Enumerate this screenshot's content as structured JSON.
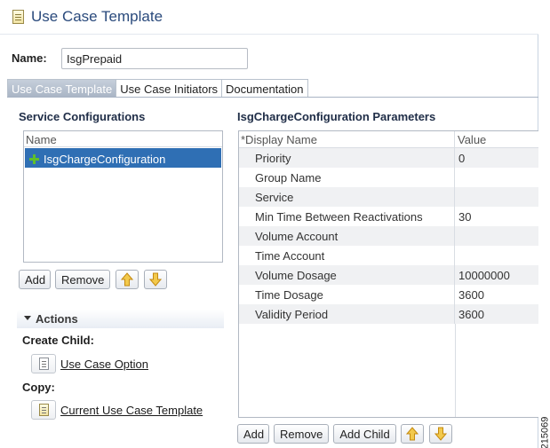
{
  "header": {
    "title": "Use Case Template",
    "icon": "template-doc-icon"
  },
  "name_field": {
    "label": "Name:",
    "value": "IsgPrepaid"
  },
  "tabs": [
    {
      "label": "Use Case Template",
      "active": true
    },
    {
      "label": "Use Case Initiators",
      "active": false
    },
    {
      "label": "Documentation",
      "active": false
    }
  ],
  "service_configurations": {
    "title": "Service Configurations",
    "column_header": "Name",
    "items": [
      {
        "label": "IsgChargeConfiguration",
        "selected": true,
        "icon": "plus-icon"
      }
    ],
    "buttons": {
      "add": "Add",
      "remove": "Remove",
      "up": "⇧",
      "down": "⇩"
    }
  },
  "actions": {
    "title": "Actions",
    "create_child_label": "Create Child:",
    "create_child_link": "Use Case Option",
    "copy_label": "Copy:",
    "copy_link": "Current Use Case Template"
  },
  "parameters": {
    "title": "IsgChargeConfiguration Parameters",
    "columns": [
      "*Display Name",
      "Value"
    ],
    "rows": [
      {
        "name": "Priority",
        "value": "0"
      },
      {
        "name": "Group Name",
        "value": ""
      },
      {
        "name": "Service",
        "value": ""
      },
      {
        "name": "Min Time Between Reactivations",
        "value": "30"
      },
      {
        "name": "Volume Account",
        "value": ""
      },
      {
        "name": "Time Account",
        "value": ""
      },
      {
        "name": "Volume Dosage",
        "value": "10000000"
      },
      {
        "name": "Time Dosage",
        "value": "3600"
      },
      {
        "name": "Validity Period",
        "value": "3600"
      }
    ],
    "buttons": {
      "add": "Add",
      "remove": "Remove",
      "add_child": "Add Child",
      "up": "⇧",
      "down": "⇩"
    }
  },
  "figure_id": "215069",
  "colors": {
    "arrow_yellow": "#e8a81c",
    "selection_blue": "#2f6fb4",
    "title_blue": "#2a4a7c"
  }
}
